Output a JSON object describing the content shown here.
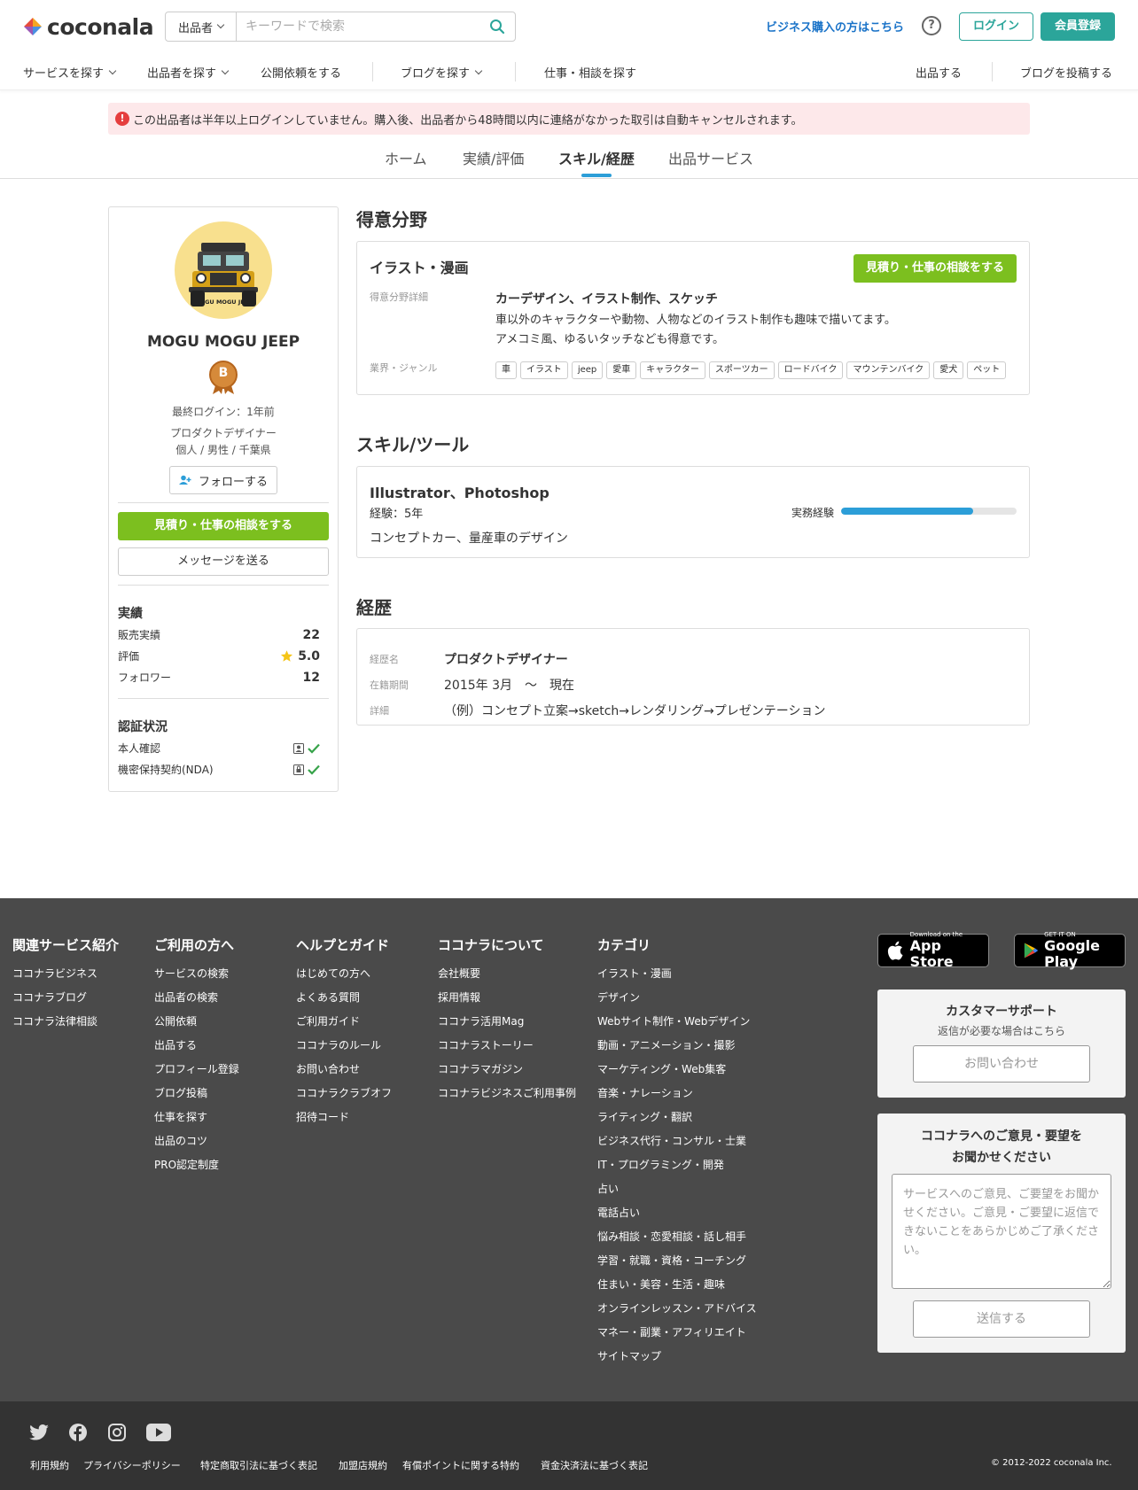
{
  "header": {
    "logo_text": "coconala",
    "search_select": "出品者",
    "search_placeholder": "キーワードで検索",
    "business_link": "ビジネス購入の方はこちら",
    "help": "?",
    "login": "ログイン",
    "register": "会員登録",
    "accent": "#2ba59a"
  },
  "nav": {
    "services": "サービスを探す",
    "sellers": "出品者を探す",
    "requests": "公開依頼をする",
    "blogs": "ブログを探す",
    "jobs": "仕事・相談を探す",
    "sell": "出品する",
    "post_blog": "ブログを投稿する"
  },
  "alert": "この出品者は半年以上ログインしていません。購入後、出品者から48時間以内に連絡がなかった取引は自動キャンセルされます。",
  "tabs": [
    "ホーム",
    "実績/評価",
    "スキル/経歴",
    "出品サービス"
  ],
  "active_tab": "スキル/経歴",
  "profile": {
    "name": "MOGU MOGU JEEP",
    "avatar_caption": "MOGU MOGU JEEP",
    "rank_badge": "B",
    "last_login": "最終ログイン：1年前",
    "job": "プロダクトデザイナー",
    "attrs": "個人 / 男性 / 千葉県",
    "follow": "フォローする",
    "cta": "見積り・仕事の相談をする",
    "message": "メッセージを送る",
    "stats_title": "実績",
    "sales_label": "販売実績",
    "sales": "22",
    "rating_label": "評価",
    "rating": "5.0",
    "followers_label": "フォロワー",
    "followers": "12",
    "verify_title": "認証状況",
    "verify_id": "本人確認",
    "verify_nda": "機密保持契約(NDA)"
  },
  "specialty": {
    "title": "得意分野",
    "category": "イラスト・漫画",
    "cta": "見積り・仕事の相談をする",
    "detail_label": "得意分野詳細",
    "detail_head": "カーデザイン、イラスト制作、スケッチ",
    "detail_line1": "車以外のキャラクターや動物、人物などのイラスト制作も趣味で描いてます。",
    "detail_line2": "アメコミ風、ゆるいタッチなども得意です。",
    "genre_label": "業界・ジャンル",
    "tags": [
      "車",
      "イラスト",
      "jeep",
      "愛車",
      "キャラクター",
      "スポーツカー",
      "ロードバイク",
      "マウンテンバイク",
      "愛犬",
      "ペット"
    ]
  },
  "skills": {
    "title": "スキル/ツール",
    "name": "Illustrator、Photoshop",
    "years": "経験：5年",
    "level_label": "実務経験",
    "level": 0.75,
    "desc": "コンセプトカー、量産車のデザイン"
  },
  "career": {
    "title": "経歴",
    "name_label": "経歴名",
    "name": "プロダクトデザイナー",
    "period_label": "在籍期間",
    "period": "2015年 3月　〜　現在",
    "detail_label": "詳細",
    "detail": "（例）コンセプト立案→sketch→レンダリング→プレゼンテーション"
  },
  "footer": {
    "cols": [
      {
        "title": "関連サービス紹介",
        "links": [
          "ココナラビジネス",
          "ココナラブログ",
          "ココナラ法律相談"
        ]
      },
      {
        "title": "ご利用の方へ",
        "links": [
          "サービスの検索",
          "出品者の検索",
          "公開依頼",
          "出品する",
          "プロフィール登録",
          "ブログ投稿",
          "仕事を探す",
          "出品のコツ",
          "PRO認定制度"
        ]
      },
      {
        "title": "ヘルプとガイド",
        "links": [
          "はじめての方へ",
          "よくある質問",
          "ご利用ガイド",
          "ココナラのルール",
          "お問い合わせ",
          "ココナラクラブオフ",
          "招待コード"
        ]
      },
      {
        "title": "ココナラについて",
        "links": [
          "会社概要",
          "採用情報",
          "ココナラ活用Mag",
          "ココナラストーリー",
          "ココナラマガジン",
          "ココナラビジネスご利用事例"
        ]
      },
      {
        "title": "カテゴリ",
        "links": [
          "イラスト・漫画",
          "デザイン",
          "Webサイト制作・Webデザイン",
          "動画・アニメーション・撮影",
          "マーケティング・Web集客",
          "音楽・ナレーション",
          "ライティング・翻訳",
          "ビジネス代行・コンサル・士業",
          "IT・プログラミング・開発",
          "占い",
          "電話占い",
          "悩み相談・恋愛相談・話し相手",
          "学習・就職・資格・コーチング",
          "住まい・美容・生活・趣味",
          "オンラインレッスン・アドバイス",
          "マネー・副業・アフィリエイト",
          "サイトマップ"
        ]
      }
    ],
    "appstore_small": "Download on the",
    "appstore_big": "App Store",
    "gplay_small": "GET IT ON",
    "gplay_big": "Google Play",
    "support_title": "カスタマーサポート",
    "support_sub": "返信が必要な場合はこちら",
    "support_btn": "お問い合わせ",
    "feedback_title_1": "ココナラへのご意見・要望を",
    "feedback_title_2": "お聞かせください",
    "feedback_placeholder": "サービスへのご意見、ご要望をお聞かせください。ご意見・ご要望に返信できないことをあらかじめご了承ください。",
    "feedback_btn": "送信する",
    "legal": [
      "利用規約",
      "プライバシーポリシー",
      "特定商取引法に基づく表記",
      "加盟店規約",
      "有償ポイントに関する特約",
      "資金決済法に基づく表記"
    ],
    "copyright": "© 2012-2022 coconala Inc."
  }
}
